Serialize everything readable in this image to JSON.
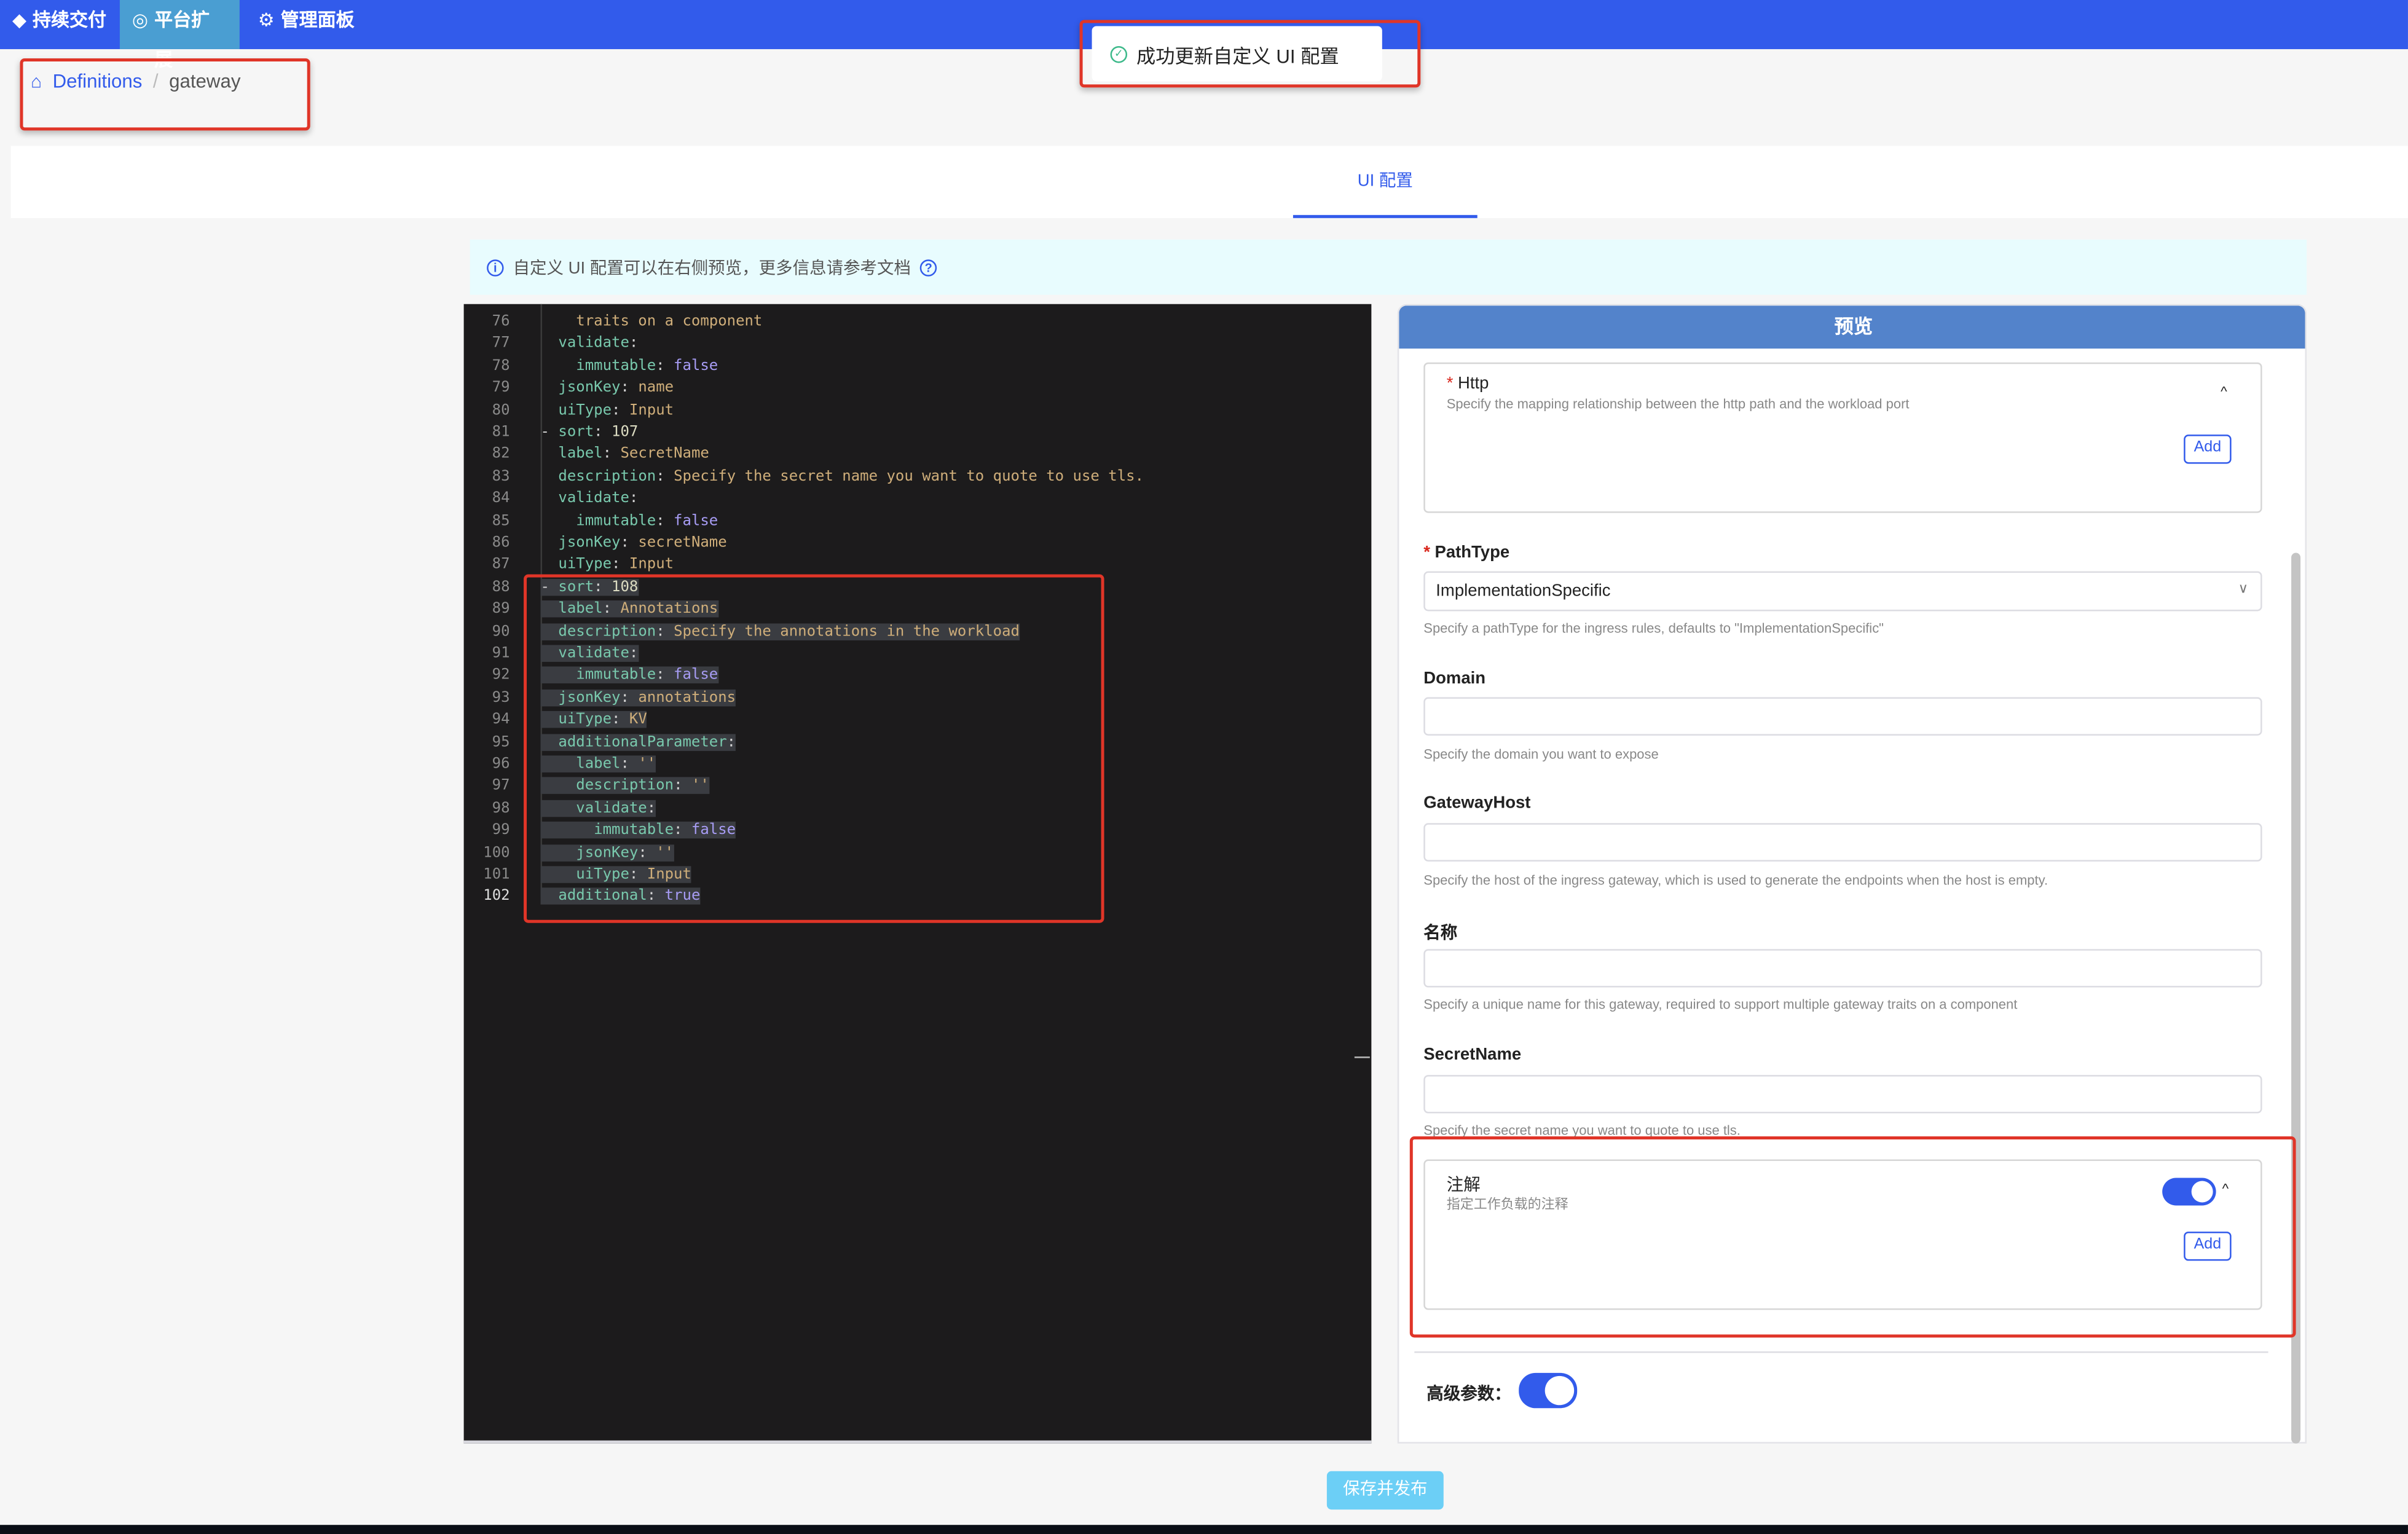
{
  "topnav": {
    "items": [
      {
        "label": "持续交付",
        "icon": "layers-icon"
      },
      {
        "label": "平台扩展",
        "icon": "extension-icon",
        "active": true
      },
      {
        "label": "管理面板",
        "icon": "gear-icon"
      }
    ],
    "color": "#325beb"
  },
  "toast": {
    "message": "成功更新自定义 UI 配置",
    "icon": "check-circle-icon"
  },
  "breadcrumb": {
    "root": "Definitions",
    "separator": "/",
    "current": "gateway"
  },
  "tabs": [
    {
      "label": "UI 配置",
      "active": true
    }
  ],
  "info": {
    "text": "自定义 UI 配置可以在右侧预览，更多信息请参考文档",
    "icon": "info-icon",
    "help_icon": "question-icon"
  },
  "editor": {
    "current_line": 102,
    "lines": [
      {
        "n": 76,
        "text": "    traits on a component"
      },
      {
        "n": 77,
        "text": "  validate:"
      },
      {
        "n": 78,
        "text": "    immutable: false"
      },
      {
        "n": 79,
        "text": "  jsonKey: name"
      },
      {
        "n": 80,
        "text": "  uiType: Input"
      },
      {
        "n": 81,
        "text": "- sort: 107"
      },
      {
        "n": 82,
        "text": "  label: SecretName"
      },
      {
        "n": 83,
        "text": "  description: Specify the secret name you want to quote to use tls."
      },
      {
        "n": 84,
        "text": "  validate:"
      },
      {
        "n": 85,
        "text": "    immutable: false"
      },
      {
        "n": 86,
        "text": "  jsonKey: secretName"
      },
      {
        "n": 87,
        "text": "  uiType: Input"
      },
      {
        "n": 88,
        "text": "- sort: 108",
        "sel": true
      },
      {
        "n": 89,
        "text": "  label: Annotations",
        "sel": true
      },
      {
        "n": 90,
        "text": "  description: Specify the annotations in the workload",
        "sel": true
      },
      {
        "n": 91,
        "text": "  validate:",
        "sel": true
      },
      {
        "n": 92,
        "text": "    immutable: false",
        "sel": true
      },
      {
        "n": 93,
        "text": "  jsonKey: annotations",
        "sel": true
      },
      {
        "n": 94,
        "text": "  uiType: KV",
        "sel": true
      },
      {
        "n": 95,
        "text": "  additionalParameter:",
        "sel": true
      },
      {
        "n": 96,
        "text": "    label: ''",
        "sel": true
      },
      {
        "n": 97,
        "text": "    description: ''",
        "sel": true
      },
      {
        "n": 98,
        "text": "    validate:",
        "sel": true
      },
      {
        "n": 99,
        "text": "      immutable: false",
        "sel": true
      },
      {
        "n": 100,
        "text": "    jsonKey: ''",
        "sel": true
      },
      {
        "n": 101,
        "text": "    uiType: Input",
        "sel": true
      },
      {
        "n": 102,
        "text": "  additional: true",
        "sel": true
      }
    ]
  },
  "preview": {
    "title": "预览",
    "http": {
      "label": "Http",
      "required": true,
      "description": "Specify the mapping relationship between the http path and the workload port",
      "add_label": "Add"
    },
    "pathtype": {
      "label": "PathType",
      "required": true,
      "value": "ImplementationSpecific",
      "help": "Specify a pathType for the ingress rules, defaults to \"ImplementationSpecific\""
    },
    "domain": {
      "label": "Domain",
      "value": "",
      "help": "Specify the domain you want to expose"
    },
    "gatewayhost": {
      "label": "GatewayHost",
      "value": "",
      "help": "Specify the host of the ingress gateway, which is used to generate the endpoints when the host is empty."
    },
    "name": {
      "label": "名称",
      "value": "",
      "help": "Specify a unique name for this gateway, required to support multiple gateway traits on a component"
    },
    "secretname": {
      "label": "SecretName",
      "value": "",
      "help": "Specify the secret name you want to quote to use tls."
    },
    "annotations": {
      "label": "注解",
      "description": "指定工作负载的注释",
      "enabled": true,
      "add_label": "Add"
    },
    "advanced": {
      "label": "高级参数：",
      "enabled": true
    }
  },
  "save_label": "保存并发布"
}
